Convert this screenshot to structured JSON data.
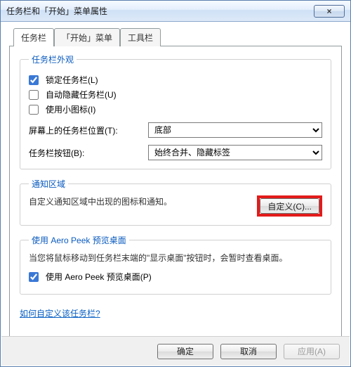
{
  "window": {
    "title": "任务栏和「开始」菜单属性",
    "close_glyph": "×"
  },
  "tabs": {
    "taskbar": "任务栏",
    "start_menu": "「开始」菜单",
    "toolbars": "工具栏"
  },
  "appearance": {
    "legend": "任务栏外观",
    "lock": "锁定任务栏(L)",
    "autohide": "自动隐藏任务栏(U)",
    "small_icons": "使用小图标(I)",
    "position_label": "屏幕上的任务栏位置(T):",
    "position_value": "底部",
    "buttons_label": "任务栏按钮(B):",
    "buttons_value": "始终合并、隐藏标签"
  },
  "notification": {
    "legend": "通知区域",
    "desc": "自定义通知区域中出现的图标和通知。",
    "customize_btn": "自定义(C)..."
  },
  "aero": {
    "legend": "使用 Aero Peek 预览桌面",
    "desc": "当您将鼠标移动到任务栏末端的\"显示桌面\"按钮时，会暂时查看桌面。",
    "checkbox": "使用 Aero Peek 预览桌面(P)"
  },
  "help_link": "如何自定义该任务栏?",
  "footer": {
    "ok": "确定",
    "cancel": "取消",
    "apply": "应用(A)"
  }
}
